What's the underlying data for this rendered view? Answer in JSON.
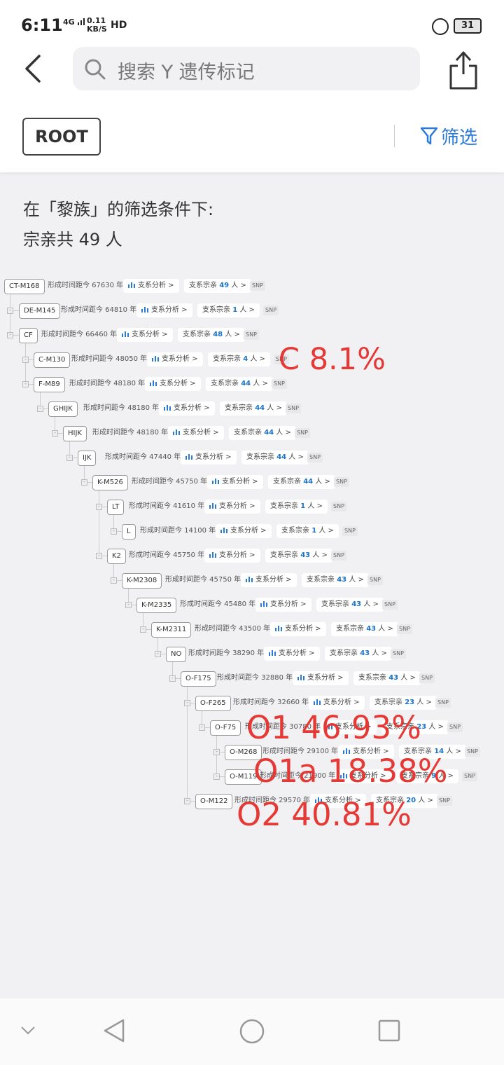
{
  "status_bar": {
    "time": "6:11",
    "network": "4G",
    "speed_value": "0.11",
    "speed_unit": "KB/S",
    "hd": "HD",
    "battery": "31"
  },
  "header": {
    "search_placeholder": "搜索 Y 遗传标记",
    "root_label": "ROOT",
    "filter_label": "筛选"
  },
  "summary": {
    "line1": "在「黎族」的筛选条件下:",
    "line2": "宗亲共 49 人"
  },
  "labels": {
    "age_prefix": "形成时间距今",
    "age_suffix": "年",
    "analysis": "支系分析",
    "kin_prefix": "支系宗亲",
    "kin_suffix": "人",
    "snp": "SNP"
  },
  "tree": [
    {
      "name": "CT-M168",
      "age": "67630",
      "count": "49"
    },
    {
      "name": "DE-M145",
      "age": "64810",
      "count": "1"
    },
    {
      "name": "CF",
      "age": "66460",
      "count": "48"
    },
    {
      "name": "C-M130",
      "age": "48050",
      "count": "4"
    },
    {
      "name": "F-M89",
      "age": "48180",
      "count": "44"
    },
    {
      "name": "GHIJK",
      "age": "48180",
      "count": "44"
    },
    {
      "name": "HIJK",
      "age": "48180",
      "count": "44"
    },
    {
      "name": "IJK",
      "age": "47440",
      "count": "44"
    },
    {
      "name": "K-M526",
      "age": "45750",
      "count": "44"
    },
    {
      "name": "LT",
      "age": "41610",
      "count": "1"
    },
    {
      "name": "L",
      "age": "14100",
      "count": "1"
    },
    {
      "name": "K2",
      "age": "45750",
      "count": "43"
    },
    {
      "name": "K-M2308",
      "age": "45750",
      "count": "43"
    },
    {
      "name": "K-M2335",
      "age": "45480",
      "count": "43"
    },
    {
      "name": "K-M2311",
      "age": "43500",
      "count": "43"
    },
    {
      "name": "NO",
      "age": "38290",
      "count": "43"
    },
    {
      "name": "O-F175",
      "age": "32880",
      "count": "43"
    },
    {
      "name": "O-F265",
      "age": "32660",
      "count": "23"
    },
    {
      "name": "O-F75",
      "age": "30780",
      "count": "23"
    },
    {
      "name": "O-M268",
      "age": "29100",
      "count": "14"
    },
    {
      "name": "O-M119",
      "age": "21900",
      "count": "9"
    },
    {
      "name": "O-M122",
      "age": "29570",
      "count": "20"
    }
  ],
  "annotations": [
    {
      "text": "C 8.1%",
      "color": "#e53935"
    },
    {
      "text": "O1 46.93%",
      "color": "#e53935"
    },
    {
      "text": "O1a 18.38%",
      "color": "#e53935"
    },
    {
      "text": "O2 40.81%",
      "color": "#e53935"
    }
  ],
  "colors": {
    "accent": "#2a7ad5",
    "count": "#1a73c8",
    "annotation": "#e53935"
  }
}
